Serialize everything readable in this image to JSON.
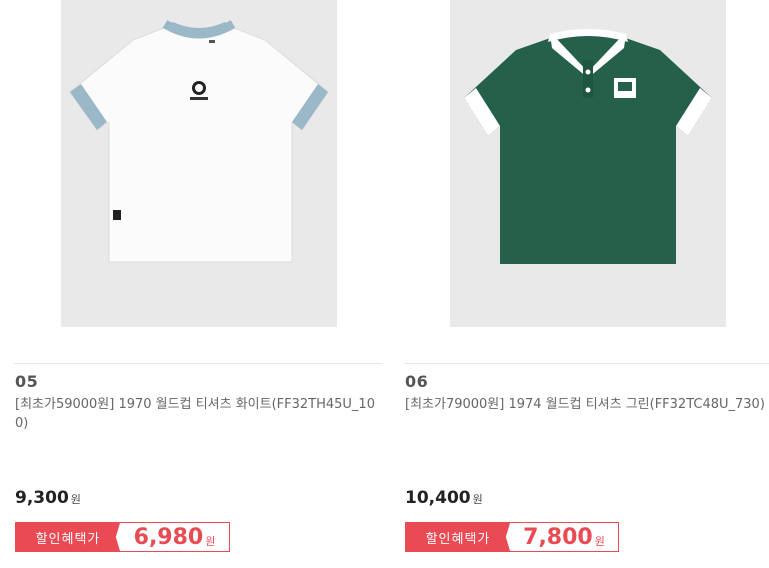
{
  "products": [
    {
      "number": "05",
      "title": "[최초가59000원] 1970 월드컵 티셔츠 화이트(FF32TH45U_100)",
      "price": "9,300",
      "currency": "원",
      "badge": "할인혜택가",
      "sale_price": "6,980",
      "shirt_color": "#fbfbfb",
      "trim_color": "#9bb8c9"
    },
    {
      "number": "06",
      "title": "[최초가79000원] 1974 월드컵 티셔츠 그린(FF32TC48U_730)",
      "price": "10,400",
      "currency": "원",
      "badge": "할인혜택가",
      "sale_price": "7,800",
      "shirt_color": "#25614a",
      "trim_color": "#ffffff"
    }
  ]
}
